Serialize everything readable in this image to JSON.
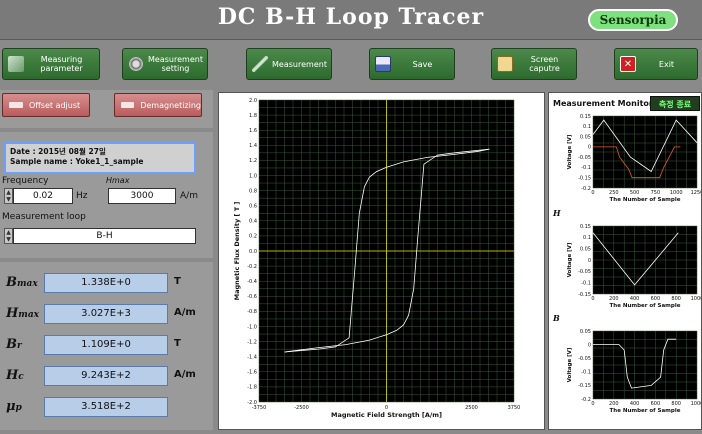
{
  "title": "DC  B-H  Loop  Tracer",
  "brand": "Sensorpia",
  "toolbar": [
    {
      "label": "Measuring parameter",
      "icon": "ruler-icon"
    },
    {
      "label": "Measurement setting",
      "icon": "gear-icon"
    },
    {
      "label": "Measurement",
      "icon": "probe-icon"
    },
    {
      "label": "Save",
      "icon": "disk-icon"
    },
    {
      "label": "Screen caputre",
      "icon": "clipboard-icon"
    },
    {
      "label": "Exit",
      "icon": "close-icon"
    }
  ],
  "actions": {
    "offset": "Offset adjust",
    "demag": "Demagnetizing"
  },
  "info": {
    "date": "Date : 2015년 08월 27일",
    "sample": "Sample name : Yoke1_1_sample"
  },
  "params": {
    "frequency_label": "Frequency",
    "frequency_value": "0.02",
    "frequency_unit": "Hz",
    "hmax_label": "Hmax",
    "hmax_value": "3000",
    "hmax_unit": "A/m",
    "loop_label": "Measurement loop",
    "loop_value": "B-H"
  },
  "results": [
    {
      "label": "Bmax",
      "value": "1.338E+0",
      "unit": "T"
    },
    {
      "label": "Hmax",
      "value": "3.027E+3",
      "unit": "A/m"
    },
    {
      "label": "Br",
      "value": "1.109E+0",
      "unit": "T"
    },
    {
      "label": "Hc",
      "value": "9.243E+2",
      "unit": "A/m"
    },
    {
      "label": "μp",
      "value": "3.518E+2",
      "unit": ""
    }
  ],
  "monitor": {
    "title": "Measurement Monitoring",
    "status": "측정 종료",
    "h_label": "H",
    "b_label": "B"
  },
  "colors": {
    "green_button": "#3a7a3a",
    "red_button": "#c87070",
    "plot_bg": "#000000",
    "grid": "#3a5a3a",
    "axis_cross": "#e0e000",
    "loop_line": "#ffffff",
    "result_box": "#b8cde8"
  },
  "chart_data": [
    {
      "type": "line",
      "title": "",
      "xlabel": "Magnetic Field Strength [A/m]",
      "ylabel": "Magnetic Flux Density [ T ]",
      "xlim": [
        -3750,
        3750
      ],
      "ylim": [
        -2.0,
        2.0
      ],
      "x_ticks": [
        "-3750",
        "-2500",
        "0",
        "2500",
        "3750"
      ],
      "y_ticks": [
        "2.0",
        "1.8",
        "1.6",
        "1.4",
        "1.2",
        "1.0",
        "0.8",
        "0.6",
        "0.4",
        "0.2",
        "0.0",
        "-0.2",
        "-0.4",
        "-0.6",
        "-0.8",
        "-1.0",
        "-1.2",
        "-1.4",
        "-1.6",
        "-1.8",
        "-2.0"
      ],
      "grid": true,
      "series": [
        {
          "x": [
            -3000,
            -2000,
            -1500,
            -1100,
            -924,
            -800,
            -650,
            -500,
            -300,
            0,
            500,
            1200,
            2000,
            2700,
            3027
          ],
          "y": [
            -1.338,
            -1.3,
            -1.27,
            -1.15,
            -0.2,
            0.5,
            0.85,
            0.98,
            1.05,
            1.109,
            1.18,
            1.24,
            1.28,
            1.32,
            1.35
          ]
        },
        {
          "x": [
            3027,
            2000,
            1500,
            1100,
            924,
            800,
            650,
            500,
            300,
            0,
            -500,
            -1200,
            -2000,
            -2700,
            -3000
          ],
          "y": [
            1.35,
            1.3,
            1.27,
            1.15,
            0.2,
            -0.5,
            -0.85,
            -0.98,
            -1.05,
            -1.109,
            -1.18,
            -1.24,
            -1.28,
            -1.32,
            -1.338
          ]
        }
      ]
    },
    {
      "type": "line",
      "title": "",
      "xlabel": "The Number of Sample",
      "ylabel": "Voltage [V]",
      "xlim": [
        0,
        1250
      ],
      "ylim": [
        -0.2,
        0.15
      ],
      "x_ticks": [
        "0",
        "250",
        "500",
        "750",
        "1000",
        "1250"
      ],
      "y_ticks": [
        "0.15",
        "0.1",
        "0.05",
        "0",
        "-0.05",
        "-0.1",
        "-0.15",
        "-0.2"
      ],
      "grid": true,
      "series": [
        {
          "color": "#ffffff",
          "x": [
            0,
            130,
            450,
            700,
            1000,
            1250
          ],
          "y": [
            0.06,
            0.13,
            -0.05,
            -0.12,
            0.13,
            0.02
          ]
        },
        {
          "color": "#e06020",
          "x": [
            0,
            50,
            280,
            320,
            430,
            470,
            800,
            850,
            980,
            1050
          ],
          "y": [
            0.0,
            0.0,
            0.0,
            -0.05,
            -0.11,
            -0.15,
            -0.15,
            -0.1,
            0.0,
            0.0
          ]
        }
      ]
    },
    {
      "type": "line",
      "title": "",
      "xlabel": "The Number of Sample",
      "ylabel": "Voltage [V]",
      "xlim": [
        0,
        1000
      ],
      "ylim": [
        -0.15,
        0.15
      ],
      "x_ticks": [
        "0",
        "200",
        "400",
        "600",
        "800",
        "1000"
      ],
      "y_ticks": [
        "0.15",
        "0.1",
        "0.05",
        "0",
        "-0.05",
        "-0.1",
        "-0.15"
      ],
      "grid": true,
      "series": [
        {
          "color": "#ffffff",
          "x": [
            0,
            400,
            820
          ],
          "y": [
            0.12,
            -0.11,
            0.12
          ]
        }
      ]
    },
    {
      "type": "line",
      "title": "",
      "xlabel": "The Number of Sample",
      "ylabel": "Voltage [V]",
      "xlim": [
        0,
        1000
      ],
      "ylim": [
        -0.2,
        0.05
      ],
      "x_ticks": [
        "0",
        "200",
        "400",
        "600",
        "800",
        "1000"
      ],
      "y_ticks": [
        "0.05",
        "0",
        "-0.05",
        "-0.1",
        "-0.15",
        "-0.2"
      ],
      "grid": true,
      "series": [
        {
          "color": "#ffffff",
          "x": [
            0,
            250,
            300,
            330,
            370,
            560,
            650,
            680,
            720,
            800
          ],
          "y": [
            0.0,
            0.0,
            -0.02,
            -0.12,
            -0.16,
            -0.15,
            -0.12,
            -0.02,
            0.02,
            0.02
          ]
        }
      ]
    }
  ]
}
